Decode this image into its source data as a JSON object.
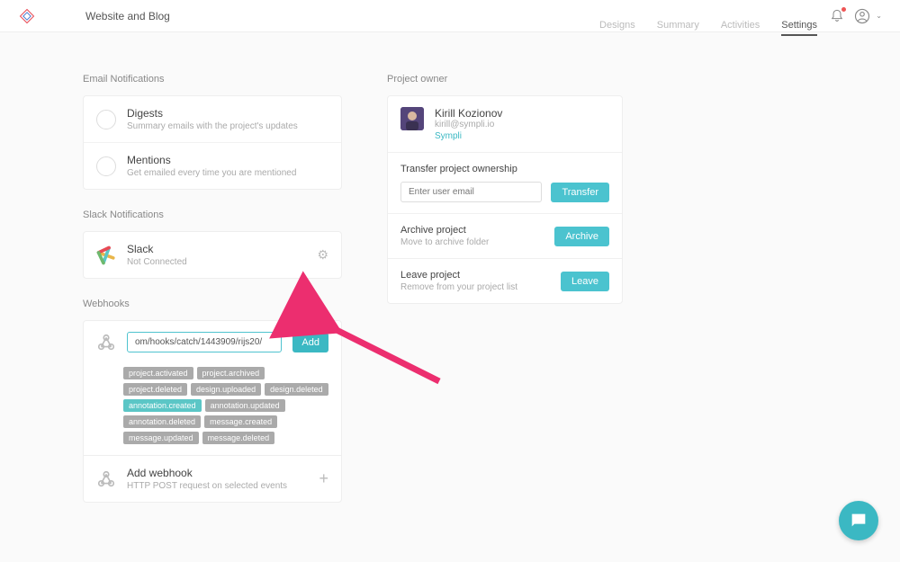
{
  "header": {
    "project": "Website and Blog"
  },
  "tabs": {
    "t1": "Designs",
    "t2": "Summary",
    "t3": "Activities",
    "t4": "Settings"
  },
  "email": {
    "section": "Email Notifications",
    "digests": {
      "title": "Digests",
      "sub": "Summary emails with the project's updates"
    },
    "mentions": {
      "title": "Mentions",
      "sub": "Get emailed every time you are mentioned"
    }
  },
  "slack": {
    "section": "Slack Notifications",
    "title": "Slack",
    "sub": "Not Connected"
  },
  "webhooks": {
    "section": "Webhooks",
    "url": "om/hooks/catch/1443909/rijs20/",
    "add": "Add",
    "tags": [
      {
        "name": "project.activated",
        "active": false
      },
      {
        "name": "project.archived",
        "active": false
      },
      {
        "name": "project.deleted",
        "active": false
      },
      {
        "name": "design.uploaded",
        "active": false
      },
      {
        "name": "design.deleted",
        "active": false
      },
      {
        "name": "annotation.created",
        "active": true
      },
      {
        "name": "annotation.updated",
        "active": false
      },
      {
        "name": "annotation.deleted",
        "active": false
      },
      {
        "name": "message.created",
        "active": false
      },
      {
        "name": "message.updated",
        "active": false
      },
      {
        "name": "message.deleted",
        "active": false
      }
    ],
    "addrow": {
      "title": "Add webhook",
      "sub": "HTTP POST request on selected events"
    }
  },
  "owner": {
    "section": "Project owner",
    "name": "Kirill Kozionov",
    "email": "kirill@sympli.io",
    "company": "Sympli",
    "transfer": {
      "title": "Transfer project ownership",
      "placeholder": "Enter user email",
      "btn": "Transfer"
    },
    "archive": {
      "title": "Archive project",
      "sub": "Move to archive folder",
      "btn": "Archive"
    },
    "leave": {
      "title": "Leave project",
      "sub": "Remove from your project list",
      "btn": "Leave"
    }
  }
}
